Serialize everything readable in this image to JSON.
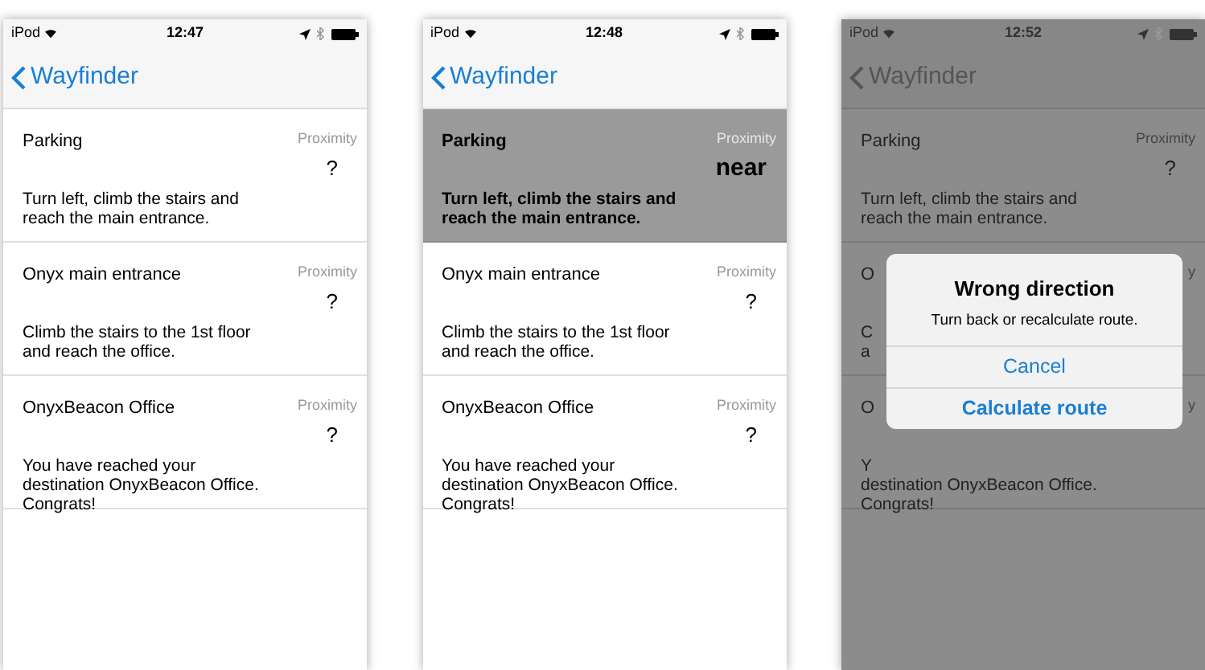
{
  "screens": [
    {
      "status": {
        "carrier": "iPod",
        "time": "12:47"
      },
      "back": "Wayfinder",
      "dimmed": false,
      "rows": [
        {
          "title": "Parking",
          "proximity_label": "Proximity",
          "proximity": "?",
          "lines": [
            "Turn left, climb the stairs and",
            "reach the main entrance."
          ],
          "selected": false
        },
        {
          "title": "Onyx main entrance",
          "proximity_label": "Proximity",
          "proximity": "?",
          "lines": [
            "Climb the stairs to the 1st floor",
            "and reach the office."
          ],
          "selected": false
        },
        {
          "title": "OnyxBeacon Office",
          "proximity_label": "Proximity",
          "proximity": "?",
          "lines": [
            "You have reached your",
            "destination OnyxBeacon Office.",
            "Congrats!"
          ],
          "selected": false
        }
      ]
    },
    {
      "status": {
        "carrier": "iPod",
        "time": "12:48"
      },
      "back": "Wayfinder",
      "dimmed": false,
      "rows": [
        {
          "title": "Parking",
          "proximity_label": "Proximity",
          "proximity": "near",
          "lines": [
            "Turn left, climb the stairs and",
            "reach the main entrance."
          ],
          "selected": true
        },
        {
          "title": "Onyx main entrance",
          "proximity_label": "Proximity",
          "proximity": "?",
          "lines": [
            "Climb the stairs to the 1st floor",
            "and reach the office."
          ],
          "selected": false
        },
        {
          "title": "OnyxBeacon Office",
          "proximity_label": "Proximity",
          "proximity": "?",
          "lines": [
            "You have reached your",
            "destination OnyxBeacon Office.",
            "Congrats!"
          ],
          "selected": false
        }
      ]
    },
    {
      "status": {
        "carrier": "iPod",
        "time": "12:52"
      },
      "back": "Wayfinder",
      "dimmed": true,
      "rows": [
        {
          "title": "Parking",
          "proximity_label": "Proximity",
          "proximity": "?",
          "lines": [
            "Turn left, climb the stairs and",
            "reach the main entrance."
          ],
          "selected": false
        },
        {
          "title": "O",
          "proximity_label": "y",
          "lines": [
            "C",
            "a"
          ],
          "selected": false
        },
        {
          "title": "O",
          "proximity_label": "y",
          "lines": [
            "Y",
            "destination OnyxBeacon Office.",
            "Congrats!"
          ],
          "selected": false
        }
      ],
      "alert": {
        "title": "Wrong direction",
        "message": "Turn back or recalculate route.",
        "buttons": [
          {
            "label": "Cancel",
            "bold": false
          },
          {
            "label": "Calculate route",
            "bold": true
          }
        ]
      }
    }
  ]
}
